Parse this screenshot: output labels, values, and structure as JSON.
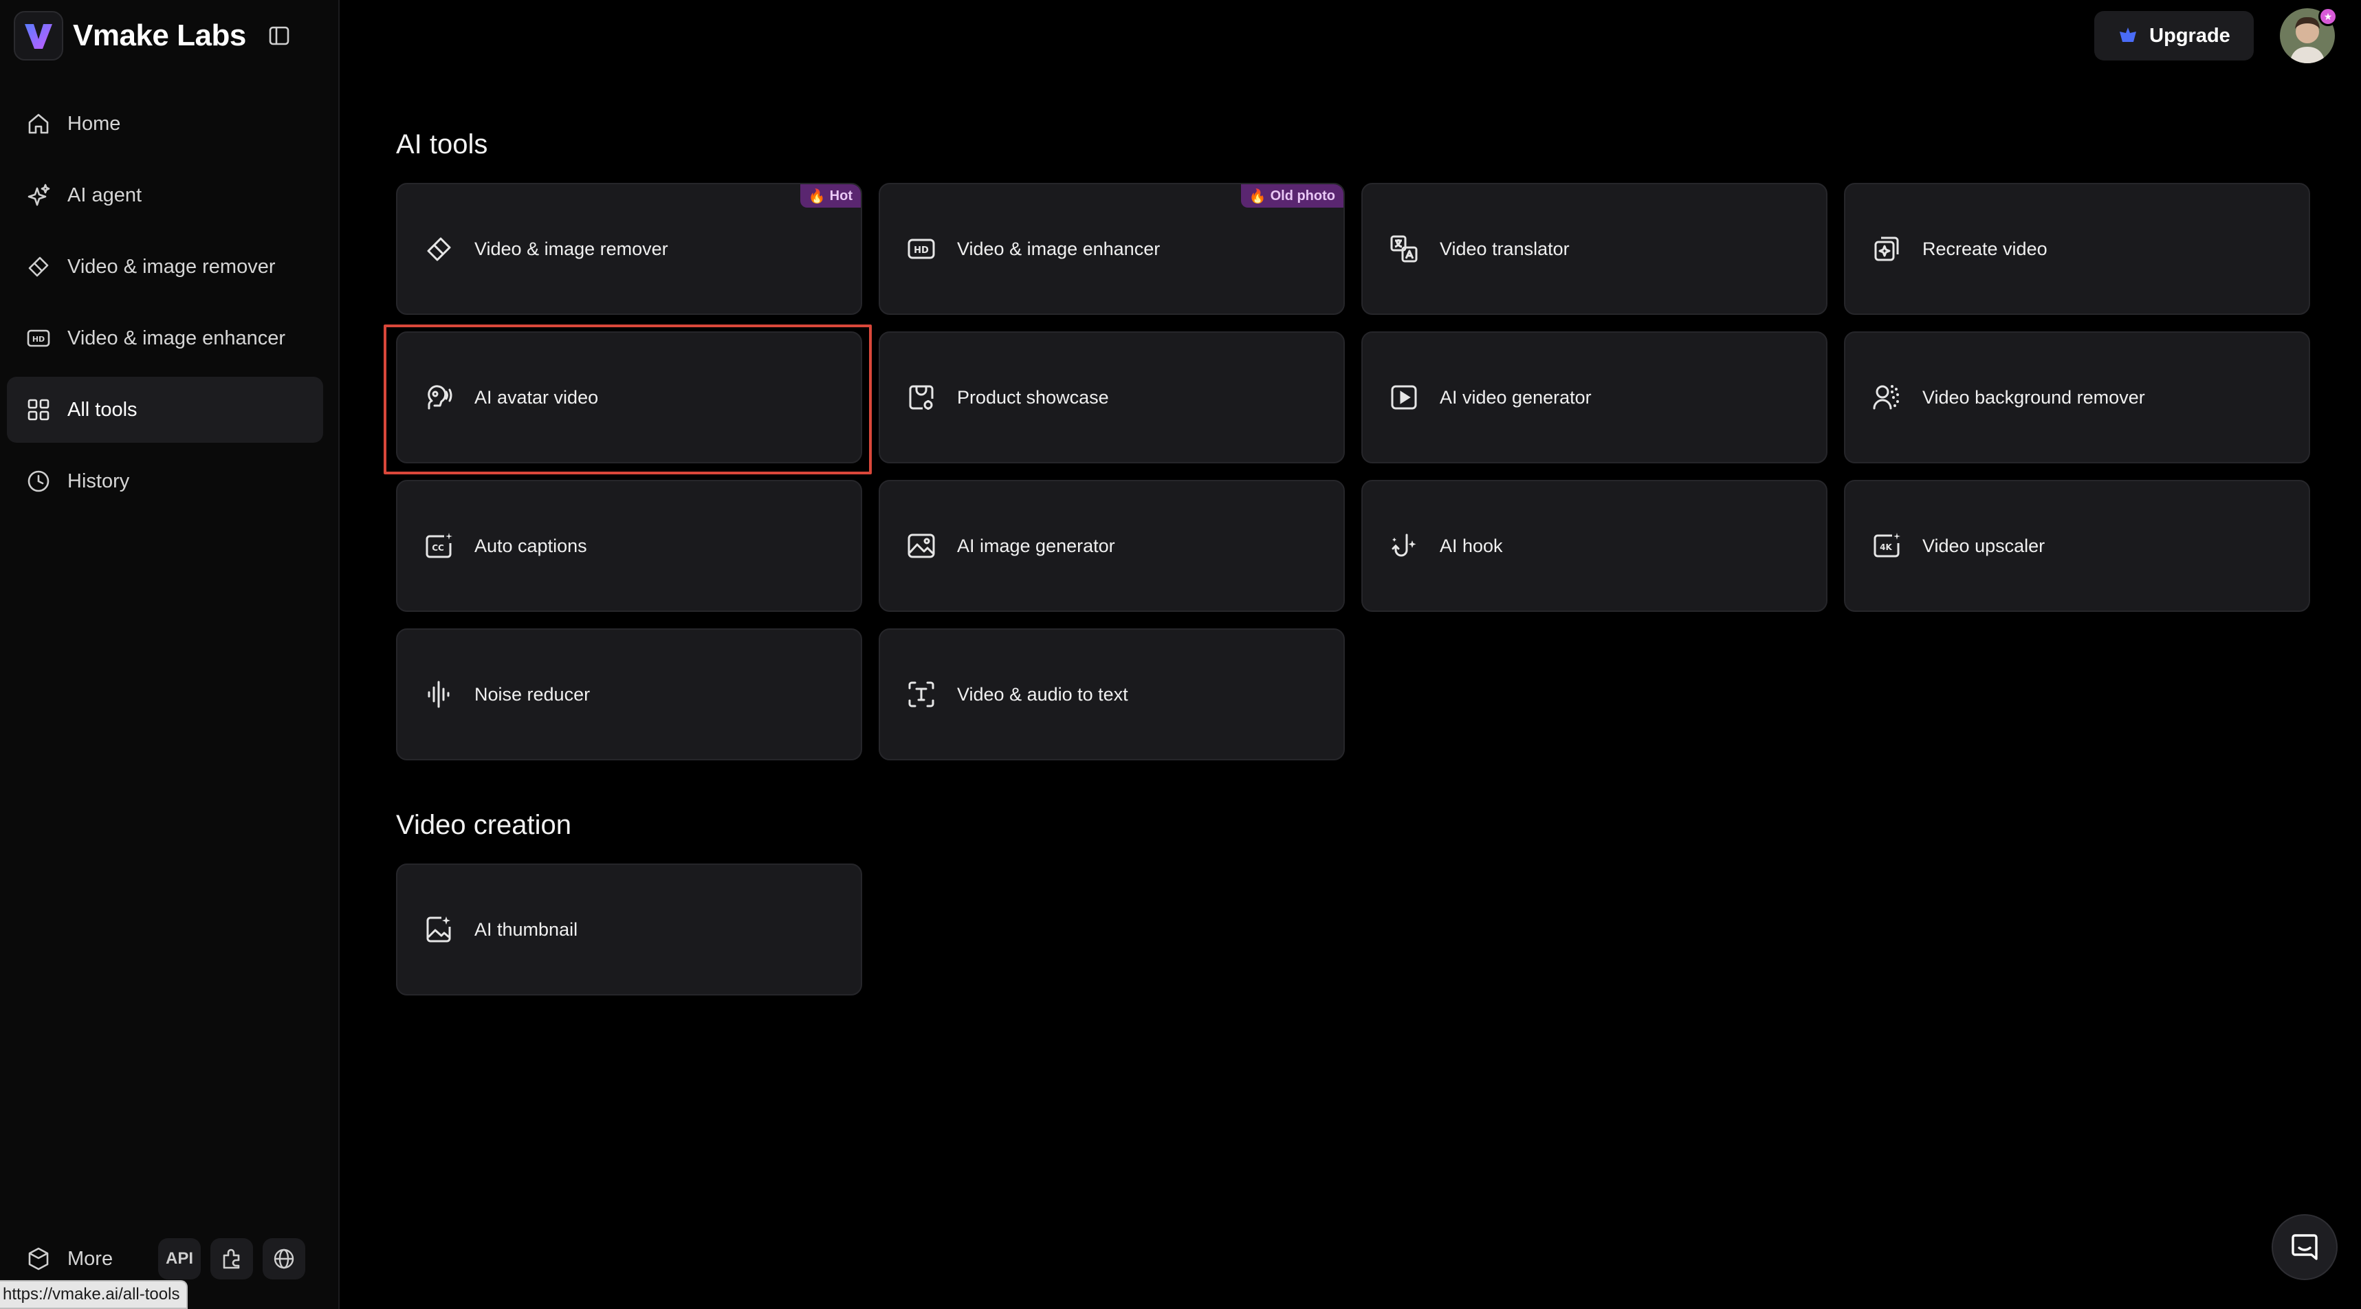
{
  "brand": {
    "name": "Vmake Labs"
  },
  "sidebar": {
    "items": [
      {
        "label": "Home",
        "icon": "home-icon"
      },
      {
        "label": "AI agent",
        "icon": "sparkle-icon"
      },
      {
        "label": "Video & image remover",
        "icon": "eraser-icon"
      },
      {
        "label": "Video & image enhancer",
        "icon": "hd-icon"
      },
      {
        "label": "All tools",
        "icon": "grid-icon",
        "active": true
      },
      {
        "label": "History",
        "icon": "clock-icon"
      }
    ],
    "more_label": "More",
    "api_label": "API"
  },
  "header": {
    "upgrade_label": "Upgrade"
  },
  "sections": {
    "ai_tools": {
      "title": "AI tools",
      "tools": [
        {
          "label": "Video & image remover",
          "icon": "eraser-icon",
          "tag": "Hot"
        },
        {
          "label": "Video & image enhancer",
          "icon": "hd-icon",
          "tag": "Old photo"
        },
        {
          "label": "Video translator",
          "icon": "translate-icon"
        },
        {
          "label": "Recreate video",
          "icon": "recreate-icon"
        },
        {
          "label": "AI avatar video",
          "icon": "avatar-speak-icon"
        },
        {
          "label": "Product showcase",
          "icon": "product-icon"
        },
        {
          "label": "AI video generator",
          "icon": "play-icon"
        },
        {
          "label": "Video background remover",
          "icon": "person-bg-icon"
        },
        {
          "label": "Auto captions",
          "icon": "cc-icon"
        },
        {
          "label": "AI image generator",
          "icon": "image-icon"
        },
        {
          "label": "AI hook",
          "icon": "hook-icon"
        },
        {
          "label": "Video upscaler",
          "icon": "4k-icon"
        },
        {
          "label": "Noise reducer",
          "icon": "waveform-icon"
        },
        {
          "label": "Video & audio to text",
          "icon": "text-scan-icon"
        }
      ]
    },
    "video_creation": {
      "title": "Video creation",
      "tools": [
        {
          "label": "AI thumbnail",
          "icon": "thumbnail-icon"
        }
      ]
    }
  },
  "statusbar": {
    "url": "https://vmake.ai/all-tools"
  },
  "colors": {
    "accent_tag_bg": "#5a2670",
    "highlight": "#d9473a",
    "card_bg": "#1a1a1d"
  }
}
